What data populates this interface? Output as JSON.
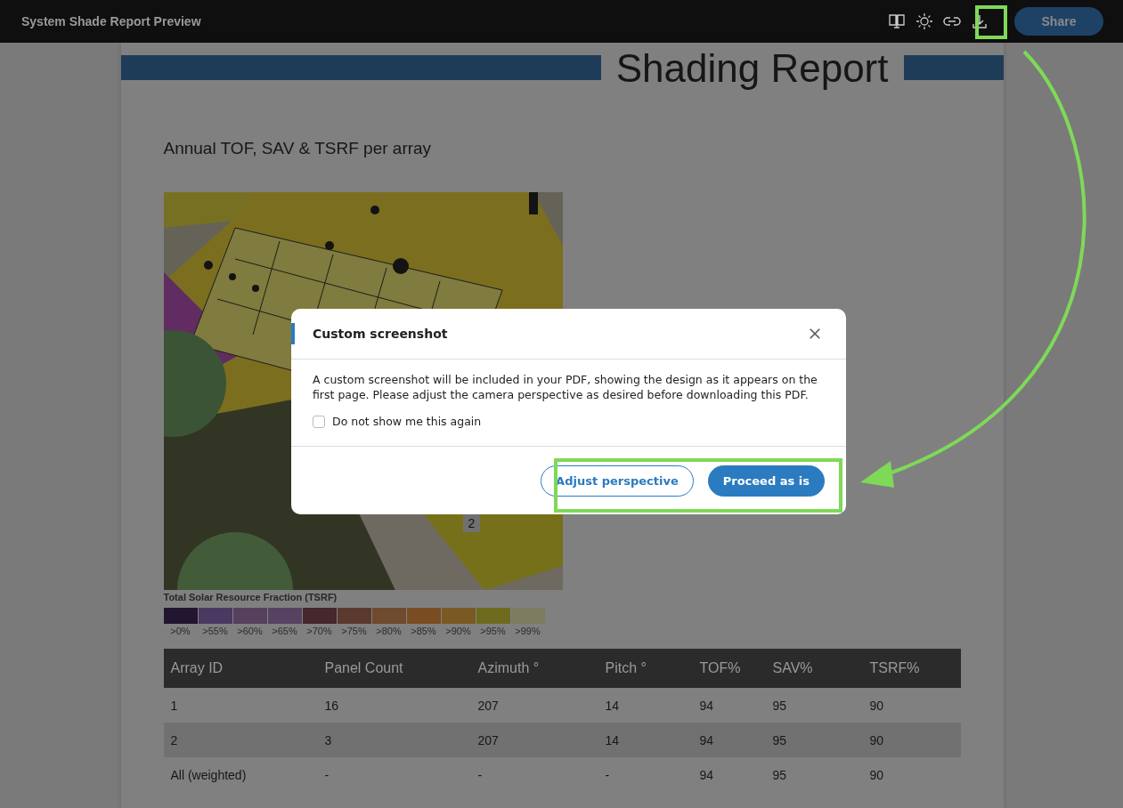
{
  "topbar": {
    "title": "System Shade Report Preview",
    "share_button": "Share"
  },
  "report": {
    "title": "Shading Report",
    "section_heading": "Annual TOF, SAV & TSRF per array",
    "map_labels": [
      "2"
    ],
    "legend": {
      "title": "Total Solar Resource Fraction (TSRF)",
      "items": [
        {
          "label": ">0%",
          "color": "#221530"
        },
        {
          "label": ">55%",
          "color": "#4a3a62"
        },
        {
          "label": ">60%",
          "color": "#56405e"
        },
        {
          "label": ">65%",
          "color": "#574262"
        },
        {
          "label": ">70%",
          "color": "#46272b"
        },
        {
          "label": ">75%",
          "color": "#5a3a2e"
        },
        {
          "label": ">80%",
          "color": "#6e4a2e"
        },
        {
          "label": ">85%",
          "color": "#7a4e22"
        },
        {
          "label": ">90%",
          "color": "#7a5a22"
        },
        {
          "label": ">95%",
          "color": "#6e6a1e"
        },
        {
          "label": ">99%",
          "color": "#7c7c60"
        }
      ]
    },
    "table": {
      "columns": [
        "Array ID",
        "Panel Count",
        "Azimuth °",
        "Pitch °",
        "TOF%",
        "SAV%",
        "TSRF%"
      ],
      "rows": [
        [
          "1",
          "16",
          "207",
          "14",
          "94",
          "95",
          "90"
        ],
        [
          "2",
          "3",
          "207",
          "14",
          "94",
          "95",
          "90"
        ],
        [
          "All (weighted)",
          "-",
          "-",
          "-",
          "94",
          "95",
          "90"
        ]
      ]
    }
  },
  "dialog": {
    "title": "Custom screenshot",
    "message": "A custom screenshot will be included in your PDF, showing the design as it appears on the first page. Please adjust the camera perspective as desired before downloading this PDF.",
    "checkbox": {
      "label": "Do not show me this again",
      "checked": false
    },
    "buttons": [
      {
        "label": "Adjust perspective",
        "kind": "secondary"
      },
      {
        "label": "Proceed as is",
        "kind": "primary"
      }
    ]
  }
}
